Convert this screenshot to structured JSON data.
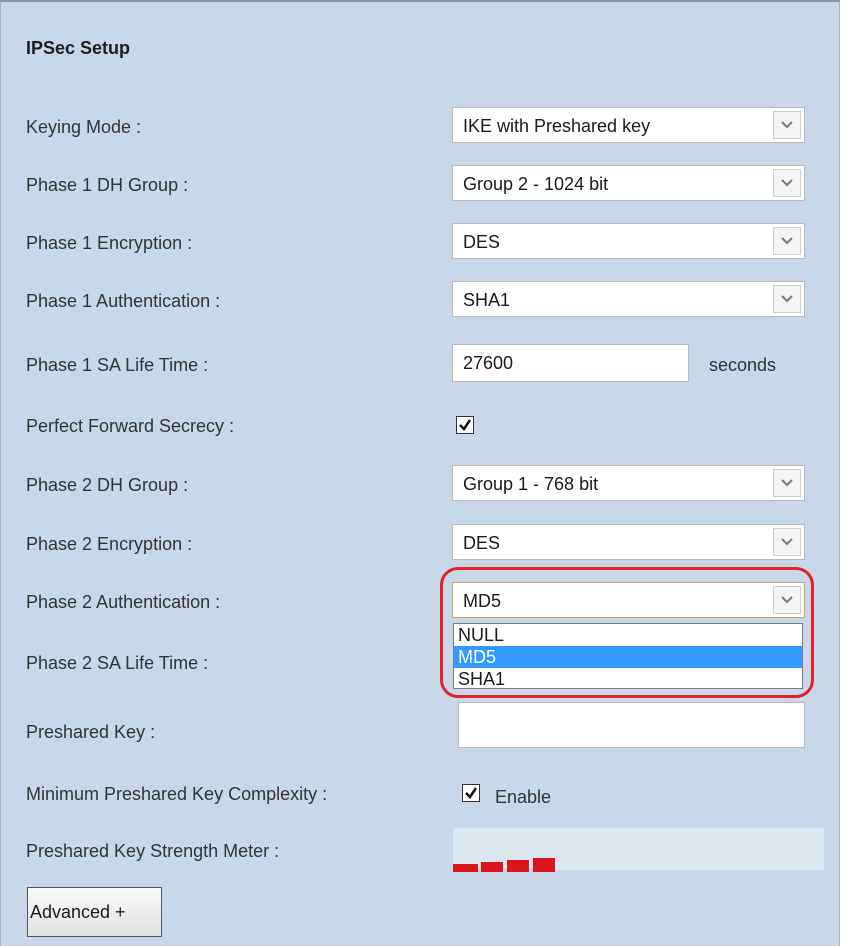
{
  "section_title": "IPSec Setup",
  "fields": {
    "keying_mode": {
      "label": "Keying Mode :",
      "value": "IKE with Preshared key"
    },
    "phase1_dh_group": {
      "label": "Phase 1 DH Group :",
      "value": "Group 2 - 1024 bit"
    },
    "phase1_encryption": {
      "label": "Phase 1 Encryption :",
      "value": "DES"
    },
    "phase1_authentication": {
      "label": "Phase 1 Authentication :",
      "value": "SHA1"
    },
    "phase1_sa_life_time": {
      "label": "Phase 1 SA Life Time :",
      "value": "27600",
      "unit": "seconds"
    },
    "perfect_forward_secrecy": {
      "label": "Perfect Forward Secrecy :",
      "checked": true
    },
    "phase2_dh_group": {
      "label": "Phase 2 DH Group :",
      "value": "Group 1 - 768 bit"
    },
    "phase2_encryption": {
      "label": "Phase 2 Encryption :",
      "value": "DES"
    },
    "phase2_authentication": {
      "label": "Phase 2 Authentication :",
      "value": "MD5",
      "options": [
        "NULL",
        "MD5",
        "SHA1"
      ],
      "selected_option": "MD5"
    },
    "phase2_sa_life_time": {
      "label": "Phase 2 SA Life Time :"
    },
    "preshared_key": {
      "label": "Preshared Key :",
      "value": ""
    },
    "min_preshared_key_complexity": {
      "label": "Minimum Preshared Key Complexity :",
      "checked": true,
      "option_label": "Enable"
    },
    "preshared_key_strength_meter": {
      "label": "Preshared Key Strength Meter :",
      "segments_filled": 4
    }
  },
  "buttons": {
    "advanced": "Advanced +"
  },
  "colors": {
    "panel_background": "#c9d8e8",
    "highlight_ring": "#e0202a",
    "selected_option": "#3399ff",
    "meter_fill": "#d8161b"
  },
  "icons": {
    "select_arrow": "chevron-down-icon",
    "checkbox_mark": "check-icon"
  }
}
